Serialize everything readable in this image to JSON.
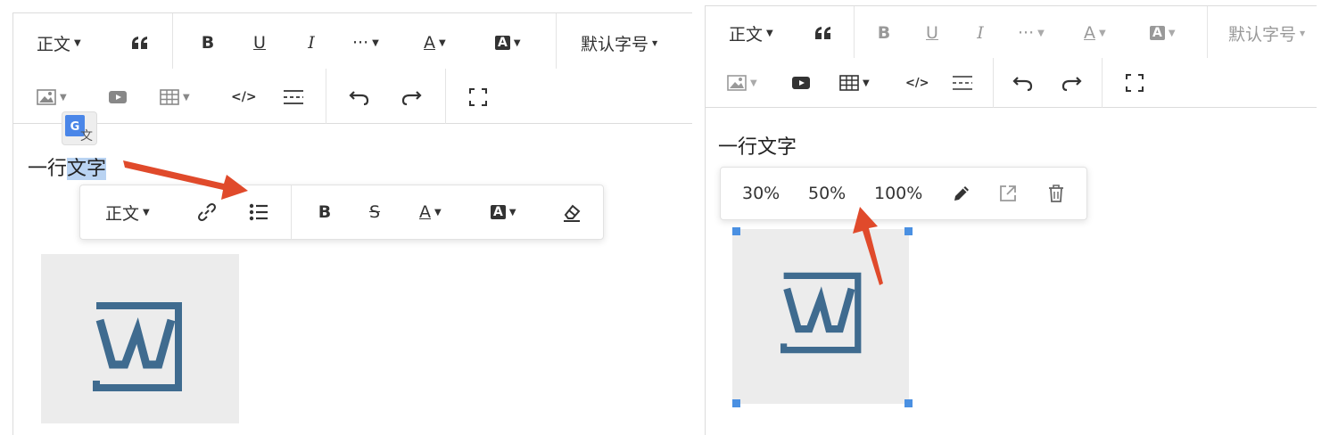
{
  "left_editor": {
    "toolbar_row1": {
      "paragraph": "正文",
      "quote_icon": "quote-icon",
      "bold": "B",
      "underline": "U",
      "italic": "I",
      "more": "···",
      "font_color": "A",
      "bg_color": "A",
      "font_size": "默认字号"
    },
    "toolbar_row2": {
      "image": "image-icon",
      "video": "video-icon",
      "table": "table-icon",
      "code": "</>",
      "divider": "divider-icon",
      "undo": "undo-icon",
      "redo": "redo-icon",
      "fullscreen": "fullscreen-icon"
    },
    "translate_badge": "文",
    "text_plain": "一行",
    "text_selected": "文字",
    "hover_bar": {
      "paragraph": "正文",
      "link": "link-icon",
      "list": "bulleted-list-icon",
      "bold": "B",
      "strike": "S",
      "font_color": "A",
      "bg_color": "A",
      "clear": "eraser-icon"
    }
  },
  "right_editor": {
    "toolbar_row1": {
      "paragraph": "正文",
      "quote_icon": "quote-icon",
      "bold": "B",
      "underline": "U",
      "italic": "I",
      "more": "···",
      "font_color": "A",
      "bg_color": "A",
      "font_size": "默认字号"
    },
    "text": "一行文字",
    "image_bar": {
      "size_30": "30%",
      "size_50": "50%",
      "size_100": "100%",
      "edit": "pencil-icon",
      "open": "external-link-icon",
      "delete": "trash-icon"
    }
  },
  "colors": {
    "arrow": "#e04a2b",
    "selection": "#b9d3f2",
    "logo": "#3f6b8f",
    "handle": "#4a90e2"
  }
}
